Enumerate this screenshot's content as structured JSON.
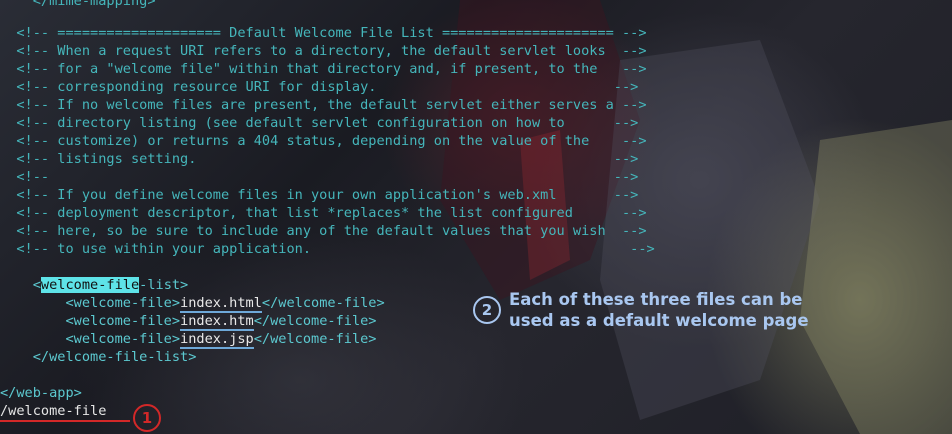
{
  "terminal": {
    "lines": {
      "l0": "    </mime-mapping>",
      "l1": "  <!-- ==================== Default Welcome File List ===================== -->",
      "l2": "  <!-- When a request URI refers to a directory, the default servlet looks  -->",
      "l3": "  <!-- for a \"welcome file\" within that directory and, if present, to the   -->",
      "l4": "  <!-- corresponding resource URI for display.                             -->",
      "l5": "  <!-- If no welcome files are present, the default servlet either serves a -->",
      "l6": "  <!-- directory listing (see default servlet configuration on how to      -->",
      "l7": "  <!-- customize) or returns a 404 status, depending on the value of the    -->",
      "l8": "  <!-- listings setting.                                                   -->",
      "l9": "  <!--                                                                     -->",
      "l10": "  <!-- If you define welcome files in your own application's web.xml       -->",
      "l11": "  <!-- deployment descriptor, that list *replaces* the list configured      -->",
      "l12": "  <!-- here, so be sure to include any of the default values that you wish  -->",
      "l13": "  <!-- to use within your application.                                       -->"
    },
    "list_open": {
      "pre": "    <",
      "match": "welcome-file",
      "post": "-list>"
    },
    "files": [
      {
        "open": "        <welcome-file>",
        "name": "index.html",
        "close": "</welcome-file>"
      },
      {
        "open": "        <welcome-file>",
        "name": "index.htm",
        "close": "</welcome-file>"
      },
      {
        "open": "        <welcome-file>",
        "name": "index.jsp",
        "close": "</welcome-file>"
      }
    ],
    "list_close": "    </welcome-file-list>",
    "webapp_close": "</web-app>",
    "search_prompt": "/welcome-file"
  },
  "annotations": {
    "badge1": "1",
    "badge2": "2",
    "note_line1": "Each of these three files can be",
    "note_line2": "used as a default welcome page"
  },
  "colors": {
    "comment": "#45b6bb",
    "highlight": "#5ee3e8",
    "annotation": "#a9c7f0",
    "marker_red": "#d32828"
  }
}
